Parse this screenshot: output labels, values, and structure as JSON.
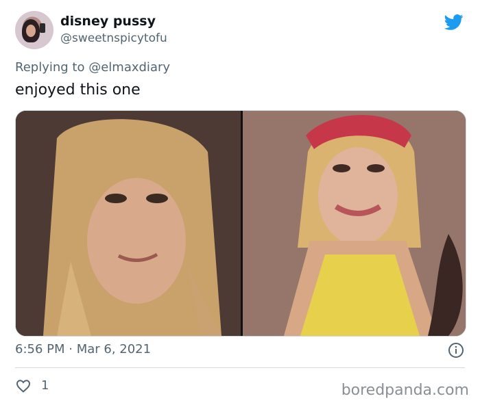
{
  "tweet": {
    "display_name": "disney pussy",
    "handle": "@sweetnspicytofu",
    "reply_prefix": "Replying to",
    "reply_to": "@elmaxdiary",
    "text": "enjoyed this one",
    "timestamp": "6:56 PM · Mar 6, 2021",
    "like_count": "1"
  },
  "watermark": "boredpanda.com",
  "colors": {
    "twitter_blue": "#1d9bf0",
    "secondary_text": "#536471",
    "border": "#cfd9de"
  },
  "icons": {
    "brand": "twitter-bird-icon",
    "info": "info-icon",
    "like": "heart-icon"
  }
}
